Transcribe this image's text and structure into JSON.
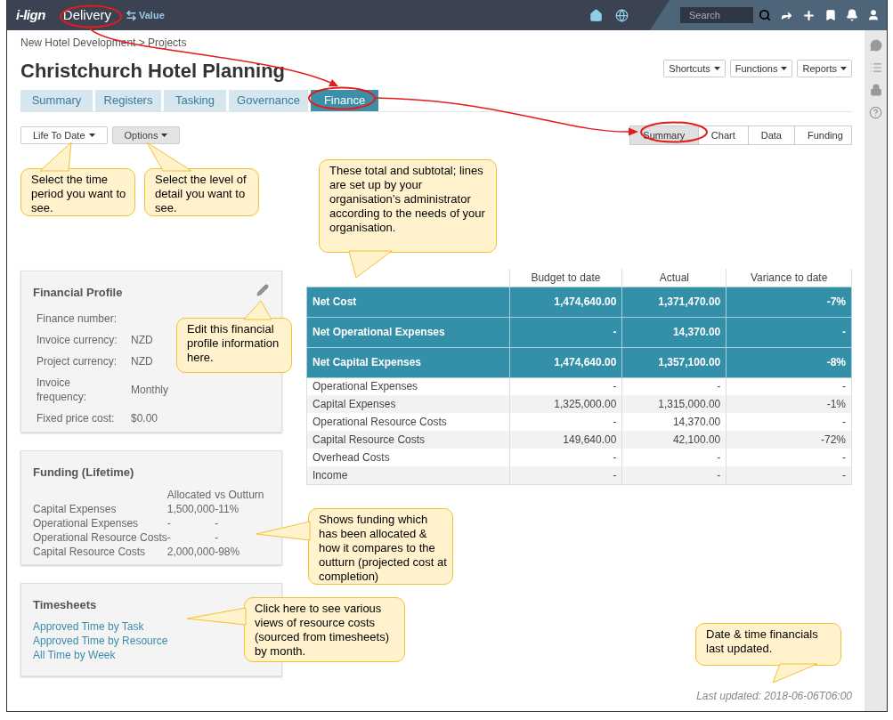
{
  "top_bar": {
    "logo": "i-lign",
    "modules": [
      {
        "label": "Delivery",
        "selected": true
      },
      {
        "label": "Value",
        "selected": false
      }
    ],
    "search": {
      "placeholder": "Search"
    }
  },
  "breadcrumb": "New Hotel Development > Projects",
  "title": "Christchurch Hotel Planning",
  "header_menus": [
    "Shortcuts",
    "Functions",
    "Reports"
  ],
  "tabs": [
    {
      "label": "Summary",
      "selected": false
    },
    {
      "label": "Registers",
      "selected": false
    },
    {
      "label": "Tasking",
      "selected": false
    },
    {
      "label": "Governance",
      "selected": false
    },
    {
      "label": "Finance",
      "selected": true
    }
  ],
  "filters": [
    {
      "label": "Life To Date",
      "kind": "outline"
    },
    {
      "label": "Options",
      "kind": "filled"
    }
  ],
  "view_tabs": [
    {
      "label": "Summary",
      "selected": true
    },
    {
      "label": "Chart",
      "selected": false
    },
    {
      "label": "Data",
      "selected": false
    },
    {
      "label": "Funding",
      "selected": false
    }
  ],
  "financial_profile": {
    "title": "Financial Profile",
    "fields": [
      {
        "label": "Finance number:"
      },
      {
        "label": "Invoice currency:",
        "value": "NZD"
      },
      {
        "label": "Project currency:",
        "value": "NZD"
      },
      {
        "label": "Invoice frequency:",
        "value": "Monthly"
      },
      {
        "label": "Fixed price cost:",
        "value": "$0.00"
      }
    ]
  },
  "funding": {
    "title": "Funding (Lifetime)",
    "columns": [
      "Allocated",
      "vs Outturn"
    ],
    "rows": [
      {
        "label": "Capital Expenses",
        "allocated": "1,500,000",
        "outturn": "-11%"
      },
      {
        "label": "Operational Expenses",
        "allocated": "-",
        "outturn": "-"
      },
      {
        "label": "Operational Resource Costs",
        "allocated": "-",
        "outturn": "-"
      },
      {
        "label": "Capital Resource Costs",
        "allocated": "2,000,000",
        "outturn": "-98%"
      }
    ]
  },
  "timesheets": {
    "title": "Timesheets",
    "links": [
      "Approved Time by Task",
      "Approved Time by Resource",
      "All Time by Week"
    ]
  },
  "table": {
    "columns": [
      "Budget to date",
      "Actual",
      "Variance to date"
    ],
    "rows": [
      {
        "label": "Net Cost",
        "kind": "total",
        "budget": "1,474,640.00",
        "actual": "1,371,470.00",
        "variance": "-7%"
      },
      {
        "label": "Net Operational Expenses",
        "kind": "total",
        "budget": "-",
        "actual": "14,370.00",
        "variance": "-"
      },
      {
        "label": "Net Capital Expenses",
        "kind": "total",
        "budget": "1,474,640.00",
        "actual": "1,357,100.00",
        "variance": "-8%"
      },
      {
        "label": "Operational Expenses",
        "kind": "detail",
        "budget": "-",
        "actual": "-",
        "variance": "-"
      },
      {
        "label": "Capital Expenses",
        "kind": "detail",
        "budget": "1,325,000.00",
        "actual": "1,315,000.00",
        "variance": "-1%"
      },
      {
        "label": "Operational Resource Costs",
        "kind": "detail",
        "budget": "-",
        "actual": "14,370.00",
        "variance": "-"
      },
      {
        "label": "Capital Resource Costs",
        "kind": "detail",
        "budget": "149,640.00",
        "actual": "42,100.00",
        "variance": "-72%"
      },
      {
        "label": "Overhead Costs",
        "kind": "detail",
        "budget": "-",
        "actual": "-",
        "variance": "-"
      },
      {
        "label": "Income",
        "kind": "detail",
        "budget": "-",
        "actual": "-",
        "variance": "-"
      }
    ]
  },
  "last_updated": "Last updated: 2018-06-06T06:00",
  "callouts": [
    "Select the time period you want to see.",
    "Select the level of detail you want to see.",
    "These total and subtotal; lines are set up by your organisation’s administrator according to the needs of your organisation.",
    "Edit this financial profile information here.",
    "Shows funding which has been allocated & how it compares to the outturn (projected cost at completion)",
    "Click here to see various views of resource costs (sourced from timesheets)  by month.",
    "Date & time financials last updated."
  ]
}
